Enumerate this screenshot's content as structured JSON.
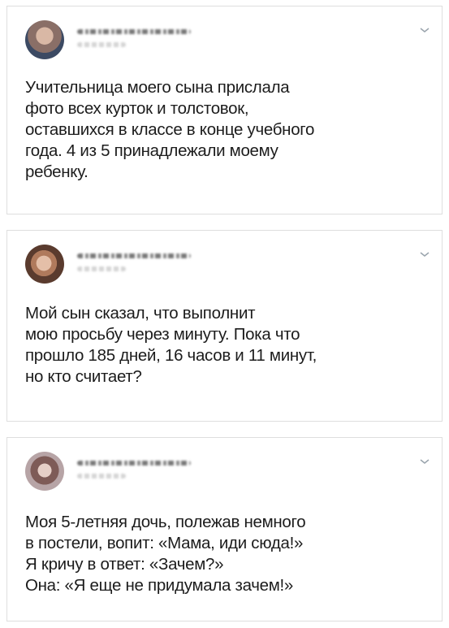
{
  "posts": [
    {
      "lines": [
        "Учительница моего сына прислала",
        "фото всех курток и толстовок,",
        "оставшихся в классе в конце учебного",
        "года. 4 из 5 принадлежали моему",
        "ребенку."
      ]
    },
    {
      "lines": [
        "Мой сын сказал, что выполнит",
        "мою просьбу через минуту. Пока что",
        "прошло 185 дней, 16 часов и 11 минут,",
        "но кто считает?"
      ]
    },
    {
      "lines": [
        "Моя 5-летняя дочь, полежав немного",
        "в постели, вопит: «Мама, иди сюда!»",
        "Я кричу в ответ: «Зачем?»",
        "Она: «Я еще не придумала зачем!»"
      ]
    }
  ],
  "icons": {
    "avatar": "avatar-photo",
    "menu": "chevron-down-icon"
  }
}
